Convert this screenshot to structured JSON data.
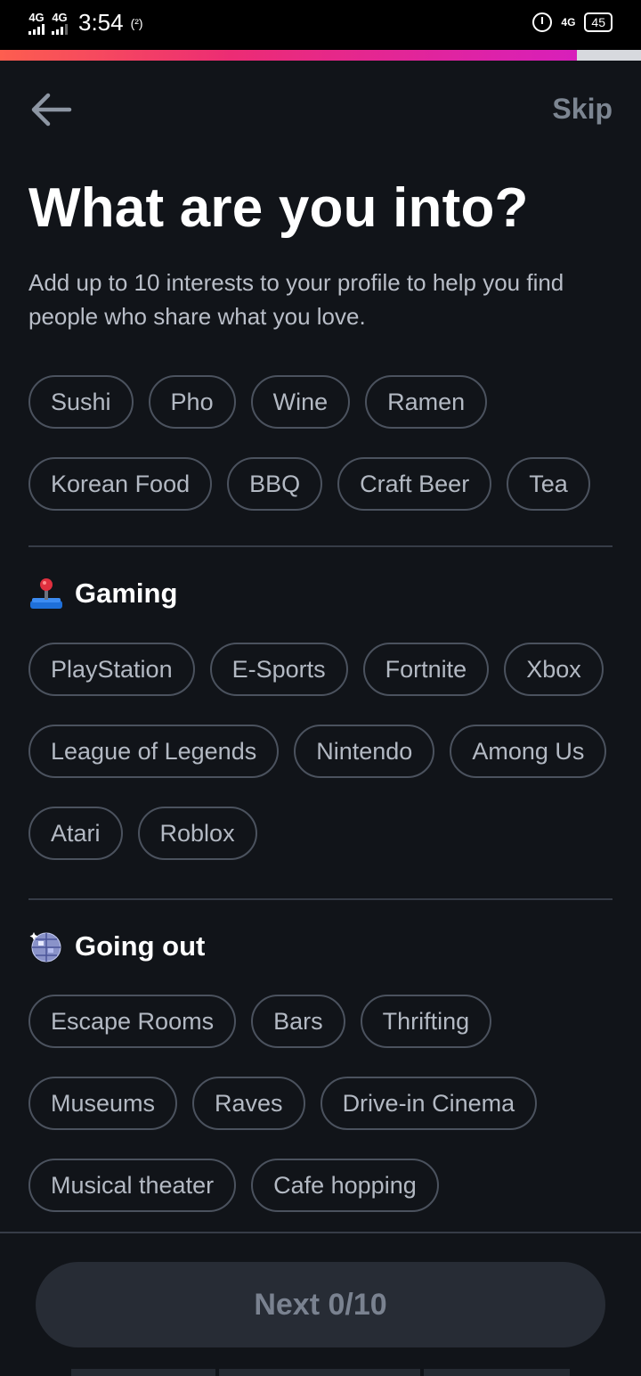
{
  "status": {
    "net1": "4G",
    "net2": "4G",
    "time": "3:54",
    "hotspot": "(²)",
    "net3": "4G",
    "battery": "45"
  },
  "progress": {
    "fraction": 0.9
  },
  "header": {
    "back_icon": "arrow-left-icon",
    "skip": "Skip"
  },
  "title": "What are you into?",
  "subtitle": "Add up to 10 interests to your profile to help you find people who share what you love.",
  "food": {
    "chips": [
      "Sushi",
      "Pho",
      "Wine",
      "Ramen",
      "Korean Food",
      "BBQ",
      "Craft Beer",
      "Tea"
    ]
  },
  "gaming": {
    "icon": "joystick-icon",
    "label": "Gaming",
    "chips": [
      "PlayStation",
      "E-Sports",
      "Fortnite",
      "Xbox",
      "League of Legends",
      "Nintendo",
      "Among Us",
      "Atari",
      "Roblox"
    ]
  },
  "going_out": {
    "icon": "disco-ball-icon",
    "label": "Going out",
    "chips": [
      "Escape Rooms",
      "Bars",
      "Thrifting",
      "Museums",
      "Raves",
      "Drive-in Cinema",
      "Musical theater",
      "Cafe hopping"
    ]
  },
  "next_button": "Next 0/10",
  "colors": {
    "background": "#111419",
    "chip_border": "#4b525e",
    "chip_text": "#b3b9c3",
    "progress_start": "#fd5e4f",
    "progress_end": "#d81fbb",
    "button_bg": "#272c35"
  }
}
